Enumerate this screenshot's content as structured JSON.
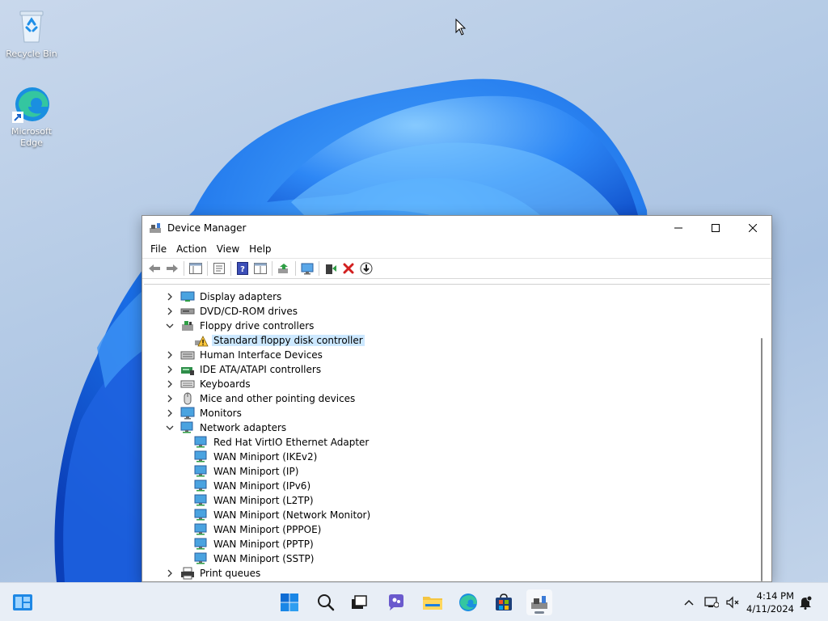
{
  "desktop": {
    "icons": [
      {
        "label": "Recycle Bin",
        "icon": "recycle-bin-icon"
      },
      {
        "label": "Microsoft Edge",
        "icon": "edge-icon"
      }
    ]
  },
  "window": {
    "title": "Device Manager",
    "menu": [
      "File",
      "Action",
      "View",
      "Help"
    ],
    "tree": [
      {
        "label": "Display adapters",
        "icon": "display-adapter-icon",
        "expanded": false,
        "level": 0
      },
      {
        "label": "DVD/CD-ROM drives",
        "icon": "dvd-drive-icon",
        "expanded": false,
        "level": 0
      },
      {
        "label": "Floppy drive controllers",
        "icon": "floppy-controller-icon",
        "expanded": true,
        "level": 0
      },
      {
        "label": "Standard floppy disk controller",
        "icon": "warning-device-icon",
        "level": 1,
        "selected": true
      },
      {
        "label": "Human Interface Devices",
        "icon": "hid-icon",
        "expanded": false,
        "level": 0
      },
      {
        "label": "IDE ATA/ATAPI controllers",
        "icon": "ide-controller-icon",
        "expanded": false,
        "level": 0
      },
      {
        "label": "Keyboards",
        "icon": "keyboard-icon",
        "expanded": false,
        "level": 0
      },
      {
        "label": "Mice and other pointing devices",
        "icon": "mouse-icon",
        "expanded": false,
        "level": 0
      },
      {
        "label": "Monitors",
        "icon": "monitor-icon",
        "expanded": false,
        "level": 0
      },
      {
        "label": "Network adapters",
        "icon": "network-adapter-icon",
        "expanded": true,
        "level": 0
      },
      {
        "label": "Red Hat VirtIO Ethernet Adapter",
        "icon": "network-adapter-icon",
        "level": 1
      },
      {
        "label": "WAN Miniport (IKEv2)",
        "icon": "network-adapter-icon",
        "level": 1
      },
      {
        "label": "WAN Miniport (IP)",
        "icon": "network-adapter-icon",
        "level": 1
      },
      {
        "label": "WAN Miniport (IPv6)",
        "icon": "network-adapter-icon",
        "level": 1
      },
      {
        "label": "WAN Miniport (L2TP)",
        "icon": "network-adapter-icon",
        "level": 1
      },
      {
        "label": "WAN Miniport (Network Monitor)",
        "icon": "network-adapter-icon",
        "level": 1
      },
      {
        "label": "WAN Miniport (PPPOE)",
        "icon": "network-adapter-icon",
        "level": 1
      },
      {
        "label": "WAN Miniport (PPTP)",
        "icon": "network-adapter-icon",
        "level": 1
      },
      {
        "label": "WAN Miniport (SSTP)",
        "icon": "network-adapter-icon",
        "level": 1
      },
      {
        "label": "Print queues",
        "icon": "printer-icon",
        "expanded": false,
        "level": 0
      }
    ]
  },
  "taskbar": {
    "time": "4:14 PM",
    "date": "4/11/2024"
  },
  "colors": {
    "selection": "#cce8ff",
    "accent": "#0067c0",
    "taskbar": "#e8eef6"
  }
}
